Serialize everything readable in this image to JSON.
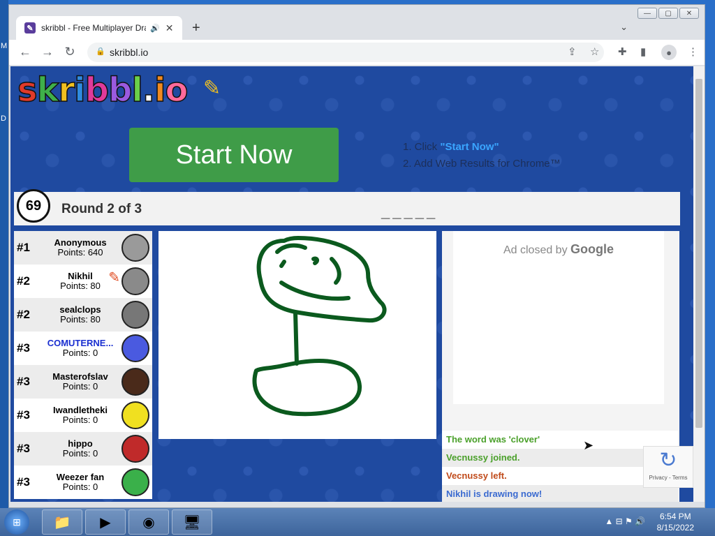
{
  "desktop": {
    "left_letters": [
      "M",
      "D"
    ]
  },
  "window_controls": {
    "minimize": "—",
    "maximize": "▢",
    "close": "✕"
  },
  "tab": {
    "title": "skribbl - Free Multiplayer Dra",
    "favicon": "✎",
    "audio_icon": "🔊",
    "close": "✕"
  },
  "browser": {
    "new_tab": "+",
    "tab_search": "⌄",
    "back": "←",
    "forward": "→",
    "reload": "↻",
    "url": "skribbl.io",
    "lock": "🔒"
  },
  "page": {
    "logo_letters": [
      {
        "ch": "s",
        "color": "#e03a2a"
      },
      {
        "ch": "k",
        "color": "#3fb04a"
      },
      {
        "ch": "r",
        "color": "#f0c020"
      },
      {
        "ch": "i",
        "color": "#2f8be0"
      },
      {
        "ch": "b",
        "color": "#e03a9a"
      },
      {
        "ch": "b",
        "color": "#9a5ae0"
      },
      {
        "ch": "l",
        "color": "#6bd04a"
      },
      {
        "ch": ".",
        "color": "#fff"
      },
      {
        "ch": "i",
        "color": "#f08a20"
      },
      {
        "ch": "o",
        "color": "#ff6a9a"
      }
    ],
    "start_button": "Start Now",
    "step1_prefix": "1. Click ",
    "step1_highlight": "\"Start Now\"",
    "step2": "2. Add Web Results for Chrome™",
    "timer": "69",
    "round": "Round 2 of 3",
    "word_hint": "_____",
    "ad_text": "Ad closed by",
    "ad_brand": "Google"
  },
  "players": [
    {
      "rank": "#1",
      "name": "Anonymous",
      "points": "Points: 640",
      "avatar_color": "#9a9a9a",
      "name_color": "#000",
      "drawing": false
    },
    {
      "rank": "#2",
      "name": "Nikhil",
      "points": "Points: 80",
      "avatar_color": "#8a8a8a",
      "name_color": "#000",
      "drawing": true
    },
    {
      "rank": "#2",
      "name": "sealclops",
      "points": "Points: 80",
      "avatar_color": "#777777",
      "name_color": "#000",
      "drawing": false
    },
    {
      "rank": "#3",
      "name": "COMUTERNE...",
      "points": "Points: 0",
      "avatar_color": "#4a5ae0",
      "name_color": "#1a2fd0",
      "drawing": false
    },
    {
      "rank": "#3",
      "name": "Masterofslav",
      "points": "Points: 0",
      "avatar_color": "#4a2a1a",
      "name_color": "#000",
      "drawing": false
    },
    {
      "rank": "#3",
      "name": "Iwandletheki",
      "points": "Points: 0",
      "avatar_color": "#f0e020",
      "name_color": "#000",
      "drawing": false
    },
    {
      "rank": "#3",
      "name": "hippo",
      "points": "Points: 0",
      "avatar_color": "#c02a2a",
      "name_color": "#000",
      "drawing": false
    },
    {
      "rank": "#3",
      "name": "Weezer fan",
      "points": "Points: 0",
      "avatar_color": "#3ab04a",
      "name_color": "#000",
      "drawing": false
    }
  ],
  "chat": [
    {
      "text": "The word was 'clover'",
      "color": "#4aa02a"
    },
    {
      "text": "Vecnussy joined.",
      "color": "#4aa02a"
    },
    {
      "text": "Vecnussy left.",
      "color": "#c04a1a"
    },
    {
      "text": "Nikhil is drawing now!",
      "color": "#3a6ad0"
    }
  ],
  "captcha": {
    "label": "Privacy - Terms"
  },
  "taskbar": {
    "start": "⊞",
    "apps": [
      "📁",
      "▶",
      "◉",
      "🖥"
    ],
    "tray": "▲  ⊟  ⚑  🔊",
    "time": "6:54 PM",
    "date": "8/15/2022"
  }
}
